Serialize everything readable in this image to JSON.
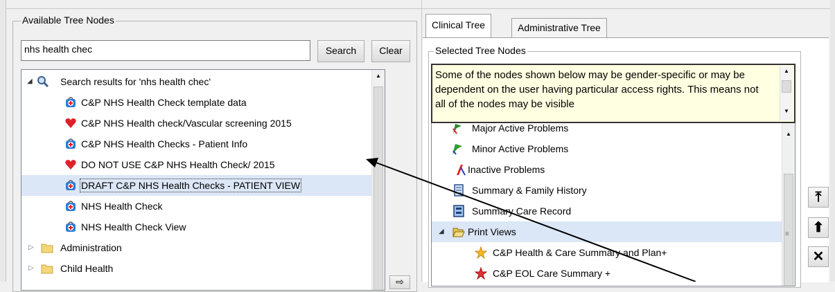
{
  "left_panel": {
    "title": "Available Tree Nodes",
    "search_value": "nhs health chec",
    "search_label": "Search",
    "clear_label": "Clear",
    "tree": [
      {
        "label": "Search results for 'nhs health chec'",
        "icon": "search-icon"
      },
      {
        "label": "C&P NHS Health Check template data",
        "icon": "medical-bag-icon"
      },
      {
        "label": "C&P NHS Health check/Vascular screening 2015",
        "icon": "heart-icon"
      },
      {
        "label": "C&P NHS Health Checks - Patient Info",
        "icon": "medical-bag-icon"
      },
      {
        "label": "DO NOT USE C&P NHS Health Check/  2015",
        "icon": "heart-icon"
      },
      {
        "label": "DRAFT C&P NHS Health Checks - PATIENT VIEW",
        "icon": "medical-bag-icon"
      },
      {
        "label": "NHS Health Check",
        "icon": "medical-bag-icon"
      },
      {
        "label": "NHS Health Check View",
        "icon": "medical-bag-icon"
      },
      {
        "label": "Administration",
        "icon": "folder-icon"
      },
      {
        "label": "Child Health",
        "icon": "folder-icon"
      }
    ]
  },
  "right_panel": {
    "tabs": [
      "Clinical Tree",
      "Administrative Tree"
    ],
    "title": "Selected Tree Nodes",
    "notice": "Some of the nodes shown below may be gender-specific or may be dependent on the user having particular access rights. This means not all of the nodes may be visible",
    "tree": [
      {
        "label": "Major Active Problems",
        "icon": "problem-flag-icon"
      },
      {
        "label": "Minor Active Problems",
        "icon": "minor-problem-icon"
      },
      {
        "label": "Inactive Problems",
        "icon": "inactive-problem-icon"
      },
      {
        "label": "Summary & Family History",
        "icon": "scroll-icon"
      },
      {
        "label": "Summary Care Record",
        "icon": "record-icon"
      },
      {
        "label": "Print Views",
        "icon": "folder-open-icon"
      },
      {
        "label": "C&P Health & Care Summary and Plan+",
        "icon": "star-icon"
      },
      {
        "label": "C&P EOL Care Summary +",
        "icon": "star-icon"
      }
    ]
  },
  "colors": {
    "selection": "#dbe6f6",
    "notice_bg": "#ffffe1",
    "heart": "#e0202a",
    "bag": "#2e7bd6"
  }
}
